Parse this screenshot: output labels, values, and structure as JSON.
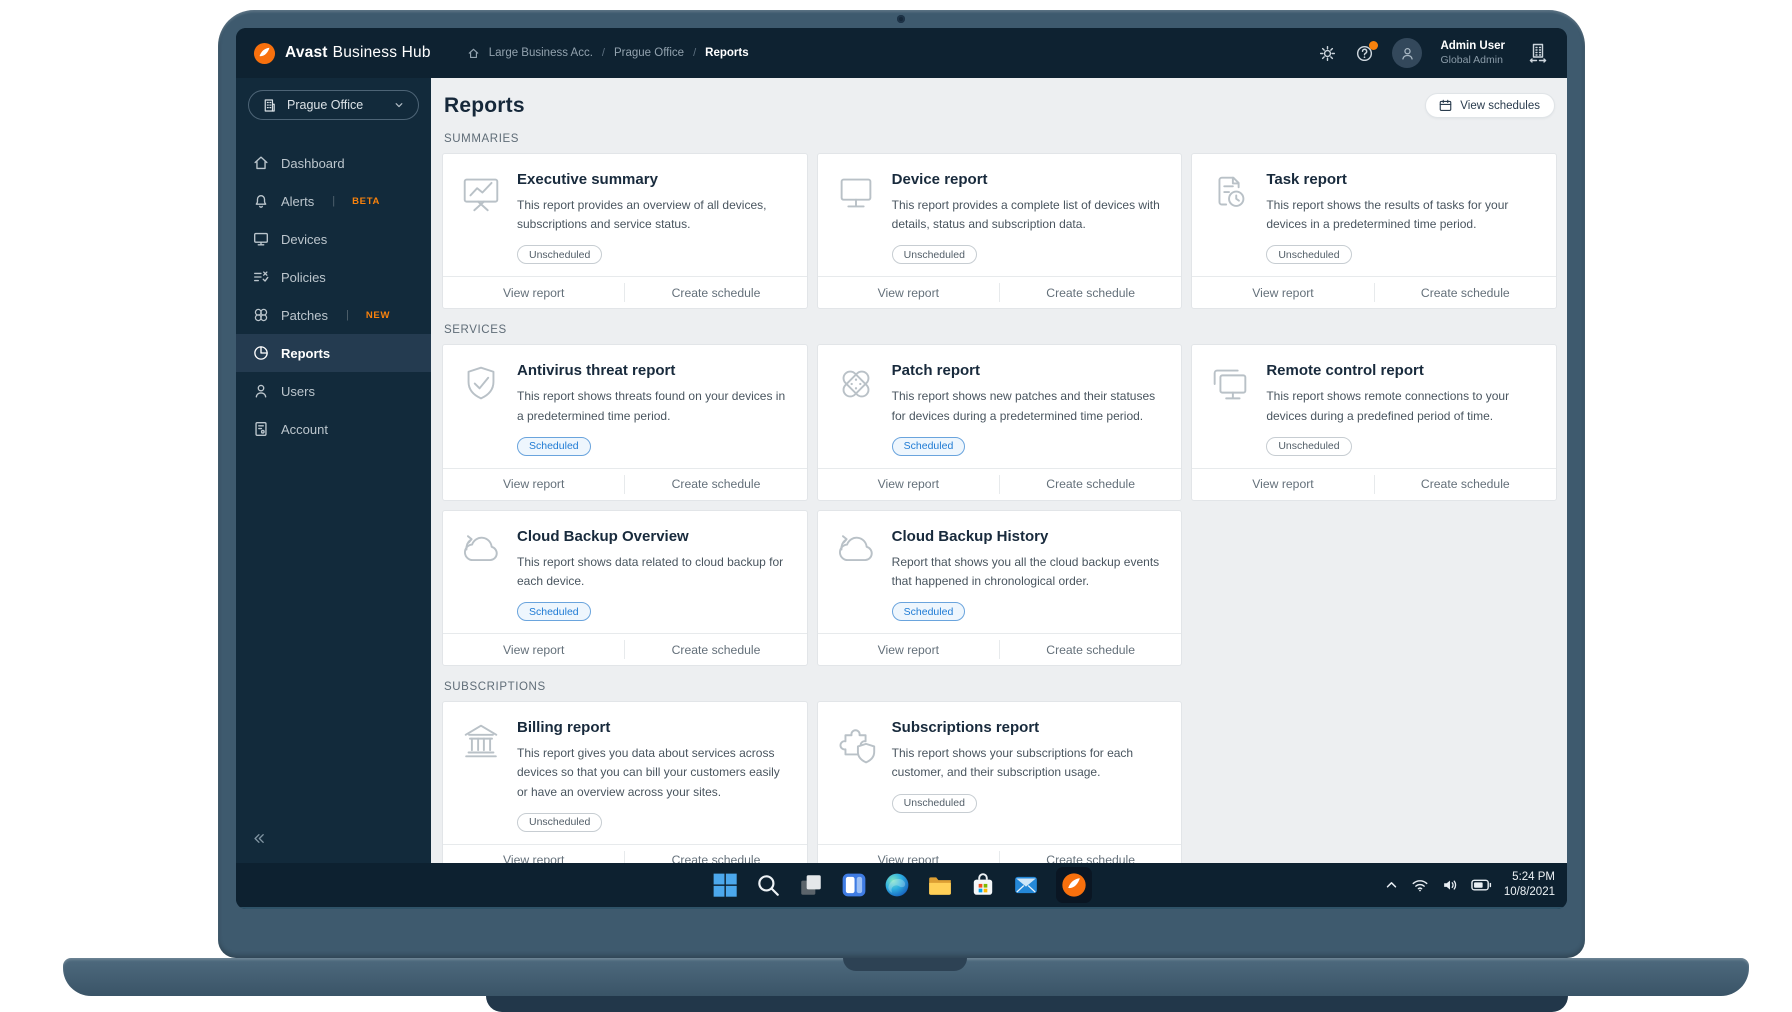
{
  "topbar": {
    "brand_bold": "Avast",
    "brand_rest": "Business Hub",
    "breadcrumb": [
      "Large Business Acc.",
      "Prague Office",
      "Reports"
    ],
    "user_name": "Admin User",
    "user_role": "Global Admin"
  },
  "sidebar": {
    "site_selector": "Prague Office",
    "items": [
      {
        "label": "Dashboard",
        "icon": "home"
      },
      {
        "label": "Alerts",
        "icon": "bell",
        "tag": "BETA"
      },
      {
        "label": "Devices",
        "icon": "device-monitor"
      },
      {
        "label": "Policies",
        "icon": "policies"
      },
      {
        "label": "Patches",
        "icon": "patches",
        "tag": "NEW"
      },
      {
        "label": "Reports",
        "icon": "reports-pie",
        "active": true
      },
      {
        "label": "Users",
        "icon": "user"
      },
      {
        "label": "Account",
        "icon": "account-card"
      }
    ]
  },
  "page": {
    "title": "Reports",
    "view_schedules_label": "View schedules",
    "card_actions": {
      "view": "View report",
      "schedule": "Create schedule"
    },
    "sections": [
      {
        "title": "SUMMARIES",
        "cards": [
          {
            "title": "Executive summary",
            "description": "This report provides an overview of all devices, subscriptions and service status.",
            "status": "Unscheduled",
            "icon": "presentation"
          },
          {
            "title": "Device report",
            "description": "This report provides a complete list of devices with details, status and subscription data.",
            "status": "Unscheduled",
            "icon": "monitor"
          },
          {
            "title": "Task report",
            "description": "This report shows the results of tasks for your devices in a predetermined time period.",
            "status": "Unscheduled",
            "icon": "task-clock"
          }
        ]
      },
      {
        "title": "SERVICES",
        "cards": [
          {
            "title": "Antivirus threat report",
            "description": "This report shows threats found on your devices in a predetermined time period.",
            "status": "Scheduled",
            "icon": "shield-check"
          },
          {
            "title": "Patch report",
            "description": "This report shows new patches and their statuses for devices during a predetermined time period.",
            "status": "Scheduled",
            "icon": "patch"
          },
          {
            "title": "Remote control report",
            "description": "This report shows remote connections to your devices during a predefined period of time.",
            "status": "Unscheduled",
            "icon": "remote-monitors"
          },
          {
            "title": "Cloud Backup Overview",
            "description": "This report shows data related to cloud backup for each device.",
            "status": "Scheduled",
            "icon": "cloud-backup"
          },
          {
            "title": "Cloud Backup History",
            "description": "Report that shows you all the cloud backup events that happened in chronological order.",
            "status": "Scheduled",
            "icon": "cloud-backup"
          }
        ]
      },
      {
        "title": "SUBSCRIPTIONS",
        "cards": [
          {
            "title": "Billing report",
            "description": "This report gives you data about services across devices so that you can bill your customers easily or have an overview across your sites.",
            "status": "Unscheduled",
            "icon": "bank"
          },
          {
            "title": "Subscriptions report",
            "description": "This report shows your subscriptions for each customer, and their subscription usage.",
            "status": "Unscheduled",
            "icon": "puzzle-shield"
          }
        ]
      }
    ]
  },
  "taskbar": {
    "apps": [
      "start",
      "search",
      "task-view",
      "widgets",
      "edge",
      "file-explorer",
      "store",
      "mail",
      "avast"
    ],
    "active_app": "avast",
    "tray_icons": [
      "hidden-icons",
      "wifi",
      "volume",
      "battery"
    ],
    "time": "5:24 PM",
    "date": "10/8/2021"
  },
  "colors": {
    "accent_orange": "#F8700D",
    "scheduled_blue": "#1F7BD4",
    "topbar_bg": "#0E2231",
    "sidebar_bg": "#122A3B",
    "content_bg": "#EDEFF1"
  }
}
